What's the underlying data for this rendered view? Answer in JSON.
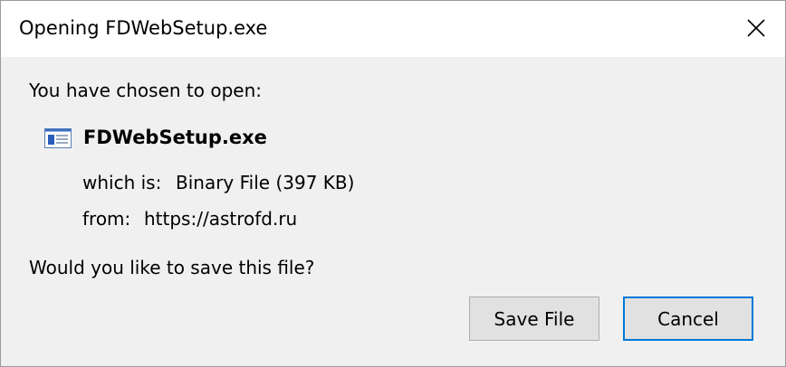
{
  "dialog": {
    "title": "Opening FDWebSetup.exe",
    "close_icon": "close-icon"
  },
  "content": {
    "intro": "You have chosen to open:",
    "file_icon": "executable-file-icon",
    "filename": "FDWebSetup.exe",
    "type_label": "which is:",
    "type_value": "Binary File (397 KB)",
    "from_label": "from:",
    "from_value": "https://astrofd.ru",
    "question": "Would you like to save this file?"
  },
  "buttons": {
    "save_label": "Save File",
    "cancel_label": "Cancel"
  },
  "colors": {
    "accent": "#0078d7",
    "background": "#f0f0f0",
    "titlebar": "#ffffff"
  }
}
